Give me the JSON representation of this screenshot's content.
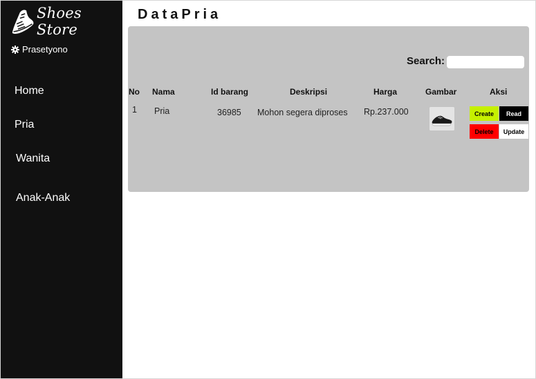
{
  "brand": {
    "name": "Shoes Store"
  },
  "user": {
    "name": "Prasetyono"
  },
  "nav": {
    "home": "Home",
    "pria": "Pria",
    "wanita": "Wanita",
    "anak": "Anak-Anak"
  },
  "page": {
    "title": "DataPria"
  },
  "search": {
    "label": "Search:",
    "value": "",
    "placeholder": ""
  },
  "table": {
    "headers": {
      "no": "No",
      "nama": "Nama",
      "id_barang": "Id barang",
      "deskripsi": "Deskripsi",
      "harga": "Harga",
      "gambar": "Gambar",
      "aksi": "Aksi"
    },
    "rows": [
      {
        "no": "1",
        "nama": "Pria",
        "id_barang": "36985",
        "deskripsi": "Mohon segera diproses",
        "harga": "Rp.237.000"
      }
    ]
  },
  "actions": {
    "create": "Create",
    "read": "Read",
    "delete": "Delete",
    "update": "Update"
  },
  "colors": {
    "sidebar": "#111111",
    "panel": "#c4c4c4",
    "create": "#c6f000",
    "read": "#000000",
    "delete": "#ff0000",
    "update": "#ffffff"
  },
  "icons": {
    "brand": "running-shoe-logo-icon",
    "user": "gear-icon",
    "product": "shoe-image"
  }
}
